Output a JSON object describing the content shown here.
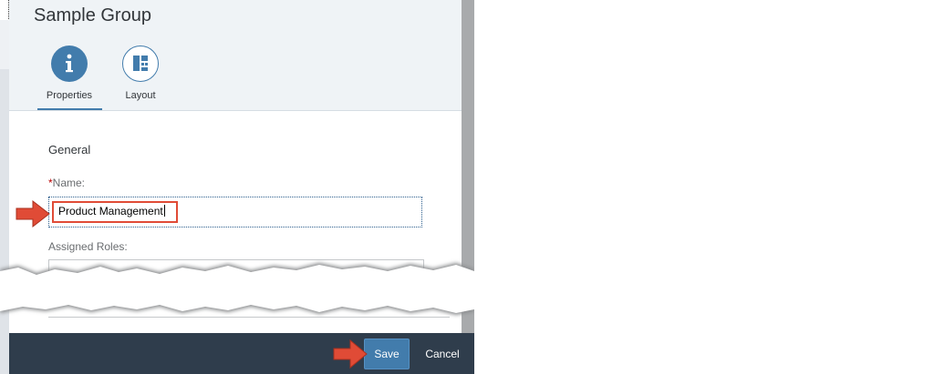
{
  "dialog": {
    "title": "Sample Group",
    "tabs": [
      {
        "label": "Properties",
        "icon": "info-icon",
        "selected": true
      },
      {
        "label": "Layout",
        "icon": "layout-icon",
        "selected": false
      }
    ],
    "section_title": "General",
    "name_field": {
      "required_mark": "*",
      "label": "Name:",
      "value": "Product Management"
    },
    "roles_field": {
      "label": "Assigned Roles:"
    }
  },
  "footer": {
    "save_label": "Save",
    "cancel_label": "Cancel"
  },
  "colors": {
    "accent": "#427cac",
    "footer_bg": "#2f3d4c",
    "header_bg": "#eff3f6",
    "highlight": "#e04b36",
    "required": "#bb0000"
  }
}
